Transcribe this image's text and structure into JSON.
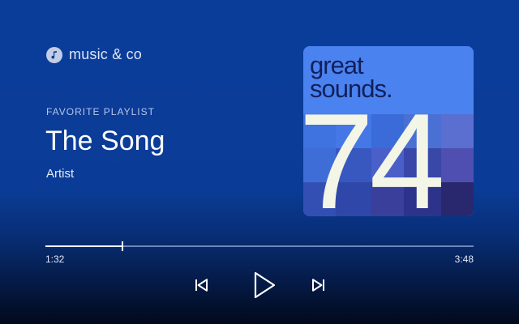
{
  "app": {
    "name": "music & co",
    "logo_icon": "music-note-icon"
  },
  "playlist": {
    "label": "FAVORITE PLAYLIST"
  },
  "track": {
    "title": "The Song",
    "artist": "Artist"
  },
  "album_art": {
    "line1": "great",
    "line2": "sounds.",
    "number": "74"
  },
  "progress": {
    "current_time": "1:32",
    "total_time": "3:48",
    "fraction": 0.18
  },
  "controls": {
    "prev_icon": "skip-previous-icon",
    "play_icon": "play-icon",
    "next_icon": "skip-next-icon"
  },
  "colors": {
    "background": "#0a3c97",
    "album_bg": "#4a82f0",
    "album_text": "#f3f5e6",
    "album_title_text": "#10205a"
  }
}
